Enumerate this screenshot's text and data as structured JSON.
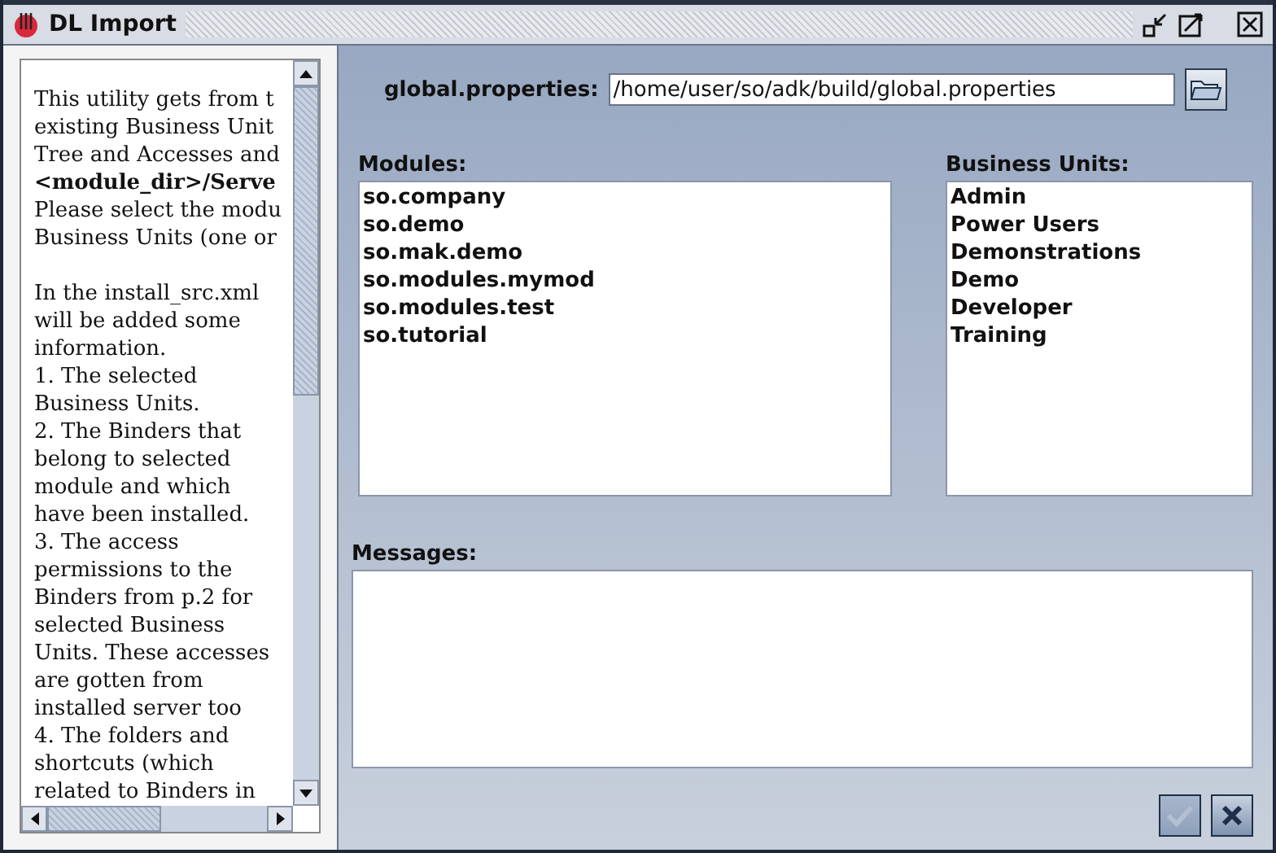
{
  "window": {
    "title": "DL Import"
  },
  "help": {
    "paragraphs": [
      {
        "lines": [
          {
            "text": "This utility gets from t",
            "bold": false
          },
          {
            "text": "existing Business Unit",
            "bold": false
          },
          {
            "text": "Tree and Accesses and",
            "bold": false
          },
          {
            "text": "<module_dir>/Serve",
            "bold": true
          },
          {
            "text": "Please select the modu",
            "bold": false
          },
          {
            "text": "Business Units (one or",
            "bold": false
          }
        ]
      },
      {
        "lines": [
          {
            "text": "In the install_src.xml",
            "bold": false
          },
          {
            "text": "will be added some",
            "bold": false
          },
          {
            "text": "information.",
            "bold": false
          },
          {
            "text": "1. The selected",
            "bold": false
          },
          {
            "text": "Business Units.",
            "bold": false
          },
          {
            "text": "2. The Binders that",
            "bold": false
          },
          {
            "text": "belong to selected",
            "bold": false
          },
          {
            "text": "module and which",
            "bold": false
          },
          {
            "text": "have been installed.",
            "bold": false
          },
          {
            "text": "3. The access",
            "bold": false
          },
          {
            "text": "permissions to the",
            "bold": false
          },
          {
            "text": "Binders from p.2 for",
            "bold": false
          },
          {
            "text": "selected Business",
            "bold": false
          },
          {
            "text": "Units. These accesses",
            "bold": false
          },
          {
            "text": "are gotten from",
            "bold": false
          },
          {
            "text": "installed server too",
            "bold": false
          },
          {
            "text": "4. The folders and",
            "bold": false
          },
          {
            "text": "shortcuts (which",
            "bold": false
          },
          {
            "text": "related to Binders in",
            "bold": false
          }
        ]
      }
    ]
  },
  "file": {
    "label": "global.properties:",
    "value": "/home/user/so/adk/build/global.properties"
  },
  "modules": {
    "label": "Modules:",
    "items": [
      "so.company",
      "so.demo",
      "so.mak.demo",
      "so.modules.mymod",
      "so.modules.test",
      "so.tutorial"
    ]
  },
  "business_units": {
    "label": "Business Units:",
    "items": [
      "Admin",
      "Power Users",
      "Demonstrations",
      "Demo",
      "Developer",
      "Training"
    ]
  },
  "messages": {
    "label": "Messages:"
  },
  "buttons": [
    {
      "kind": "ok",
      "disabled": true
    },
    {
      "kind": "cancel",
      "disabled": false
    }
  ]
}
